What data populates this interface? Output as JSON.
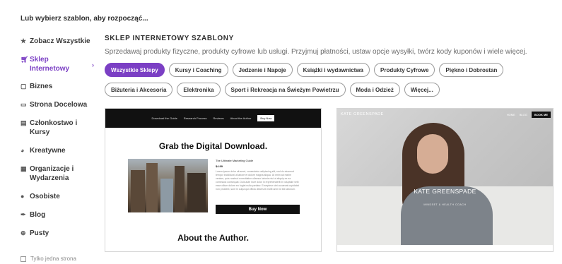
{
  "top_prompt": "Lub wybierz szablon, aby rozpocząć...",
  "sidebar": {
    "items": [
      {
        "icon": "star-icon",
        "label": "Zobacz Wszystkie"
      },
      {
        "icon": "cart-icon",
        "label": "Sklep Internetowy"
      },
      {
        "icon": "briefcase-icon",
        "label": "Biznes"
      },
      {
        "icon": "browser-icon",
        "label": "Strona Docelowa"
      },
      {
        "icon": "id-card-icon",
        "label": "Członkostwo i Kursy"
      },
      {
        "icon": "palette-icon",
        "label": "Kreatywne"
      },
      {
        "icon": "calendar-icon",
        "label": "Organizacje i Wydarzenia"
      },
      {
        "icon": "person-icon",
        "label": "Osobiste"
      },
      {
        "icon": "quill-icon",
        "label": "Blog"
      },
      {
        "icon": "plus-circle-icon",
        "label": "Pusty"
      }
    ],
    "active_index": 1,
    "single_page_label": "Tylko jedna strona"
  },
  "main": {
    "title": "SKLEP INTERNETOWY SZABLONY",
    "description": "Sprzedawaj produkty fizyczne, produkty cyfrowe lub usługi. Przyjmuj płatności, ustaw opcje wysyłki, twórz kody kuponów i wiele więcej.",
    "chips": [
      "Wszystkie Sklepy",
      "Kursy i Coaching",
      "Jedzenie i Napoje",
      "Książki i wydawnictwa",
      "Produkty Cyfrowe",
      "Piękno i Dobrostan",
      "Biżuteria i Akcesoria",
      "Elektronika",
      "Sport i Rekreacja na Świeżym Powietrzu",
      "Moda i Odzież",
      "Więcej..."
    ],
    "active_chip": 0
  },
  "template1": {
    "nav": [
      "Download the Guide",
      "Research Process",
      "Reviews",
      "About the Author"
    ],
    "nav_button": "Buy Now",
    "heading": "Grab the Digital Download.",
    "product_title": "The Ultimate Marketing Guide",
    "price": "$4.99",
    "lorem": "Lorem ipsum dolor sit amet, consectetur adipiscing elit, sed do eiusmod tempor incididunt ut labore et dolore magna aliqua. Ut enim ad minim veniam, quis nostrud exercitation ullamco laboris nisi ut aliquip ex ea commodo consequat. Duis aute irure dolor in reprehenderit in voluptate velit esse cillum dolore eu fugiat nulla pariatur. Excepteur sint occaecat cupidatat non proident, sunt in culpa qui officia deserunt mollit anim id est laborum.",
    "buy_button": "Buy Now",
    "heading2": "About the Author."
  },
  "template2": {
    "brand": "KATE GREENSPADE",
    "nav": [
      "HOME",
      "BLOG"
    ],
    "nav_button": "BOOK ME",
    "name": "KATE GREENSPADE",
    "subtitle": "MINDSET & HEALTH COACH"
  }
}
